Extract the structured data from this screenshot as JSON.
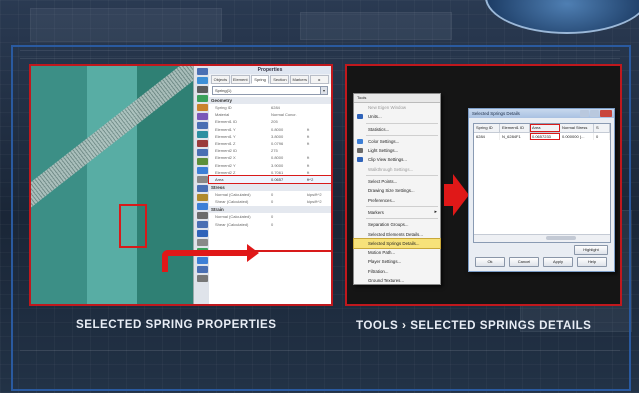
{
  "left_caption": "SELECTED SPRING PROPERTIES",
  "right_caption": {
    "part1": "TOOLS",
    "chevron": "›",
    "part2": "SELECTED SPRINGS DETAILS"
  },
  "properties": {
    "title": "Properties",
    "tabs": [
      "Objects",
      "Element",
      "Spring",
      "Section",
      "Markers",
      "▸"
    ],
    "active_tab": "Spring",
    "selector_value": "Spring(1)",
    "sections": {
      "geometry": "Geometry",
      "stress": "Stress",
      "strain": "Strain"
    },
    "rows": [
      {
        "k": "Spring ID",
        "v": "6284",
        "u": ""
      },
      {
        "k": "Material",
        "v": "Normal Concr.",
        "u": ""
      },
      {
        "k": "Element1 ID",
        "v": "205",
        "u": ""
      },
      {
        "k": "Element1 Y",
        "v": "0.8000",
        "u": "ft"
      },
      {
        "k": "Element1 Y",
        "v": "3.8000",
        "u": "ft"
      },
      {
        "k": "Element1 Z",
        "v": "0.0796",
        "u": "ft"
      },
      {
        "k": "Element2 ID",
        "v": "275",
        "u": ""
      },
      {
        "k": "Element2 X",
        "v": "0.8000",
        "u": "ft"
      },
      {
        "k": "Element2 Y",
        "v": "3.9000",
        "u": "ft"
      },
      {
        "k": "Element2 Z",
        "v": "0.7061",
        "u": "ft"
      }
    ],
    "area_row": {
      "k": "Area",
      "v": "0.0657",
      "u": "ft^2"
    },
    "stress_rows": [
      {
        "k": "Normal (Calculated)",
        "v": "0",
        "u": "kips/ft^2"
      },
      {
        "k": "Shear (Calculated)",
        "v": "0",
        "u": "kips/ft^2"
      }
    ],
    "strain_rows": [
      {
        "k": "Normal (Calculated)",
        "v": "0",
        "u": ""
      },
      {
        "k": "Shear (Calculated)",
        "v": "0",
        "u": ""
      }
    ]
  },
  "tools_menu": {
    "title": "Tools",
    "items": [
      {
        "label": "New Eigen Window",
        "dim": true,
        "icon": ""
      },
      {
        "label": "Units...",
        "dim": false,
        "icon": "#2f63b9"
      },
      {
        "sep": true
      },
      {
        "label": "Statistics...",
        "dim": false,
        "icon": ""
      },
      {
        "sep": true
      },
      {
        "label": "Color Settings...",
        "dim": false,
        "icon": "#3d7fd6"
      },
      {
        "label": "Light Settings...",
        "dim": false,
        "icon": "#6b6b6b"
      },
      {
        "label": "Clip View Settings...",
        "dim": false,
        "icon": "#2f63b9"
      },
      {
        "label": "Walkthrough Settings...",
        "dim": true,
        "icon": ""
      },
      {
        "sep": true
      },
      {
        "label": "Select Points...",
        "dim": false,
        "icon": ""
      },
      {
        "label": "Drawing Size Settings...",
        "dim": false,
        "icon": ""
      },
      {
        "label": "Preferences...",
        "dim": false,
        "icon": ""
      },
      {
        "sep": true
      },
      {
        "label": "Markers",
        "dim": false,
        "icon": "",
        "submenu": true
      },
      {
        "sep": true
      },
      {
        "label": "Separation Groups...",
        "dim": false,
        "icon": ""
      },
      {
        "label": "Selected Elements Details...",
        "dim": false,
        "icon": ""
      },
      {
        "label": "Selected Springs Details...",
        "dim": false,
        "icon": "",
        "highlight": true
      },
      {
        "label": "Motion Path...",
        "dim": false,
        "icon": ""
      },
      {
        "label": "Player Settings...",
        "dim": false,
        "icon": ""
      },
      {
        "label": "Filtration...",
        "dim": false,
        "icon": ""
      },
      {
        "label": "Ground Textures...",
        "dim": false,
        "icon": ""
      }
    ]
  },
  "dialog": {
    "title": "Selected Springs Details",
    "columns": [
      "Spring ID",
      "Element1 ID",
      "Area",
      "Normal Stress",
      "S"
    ],
    "rows": [
      [
        "6284",
        "N_6284F1",
        "0.0657233",
        "0.000000 (...",
        "0"
      ]
    ],
    "buttons": {
      "highlight": "Highlight",
      "ok": "Ok",
      "cancel": "Cancel",
      "apply": "Apply",
      "help": "Help"
    }
  },
  "colors": {
    "accent_red": "#e01818",
    "frame_blue": "#2a5aa0"
  }
}
